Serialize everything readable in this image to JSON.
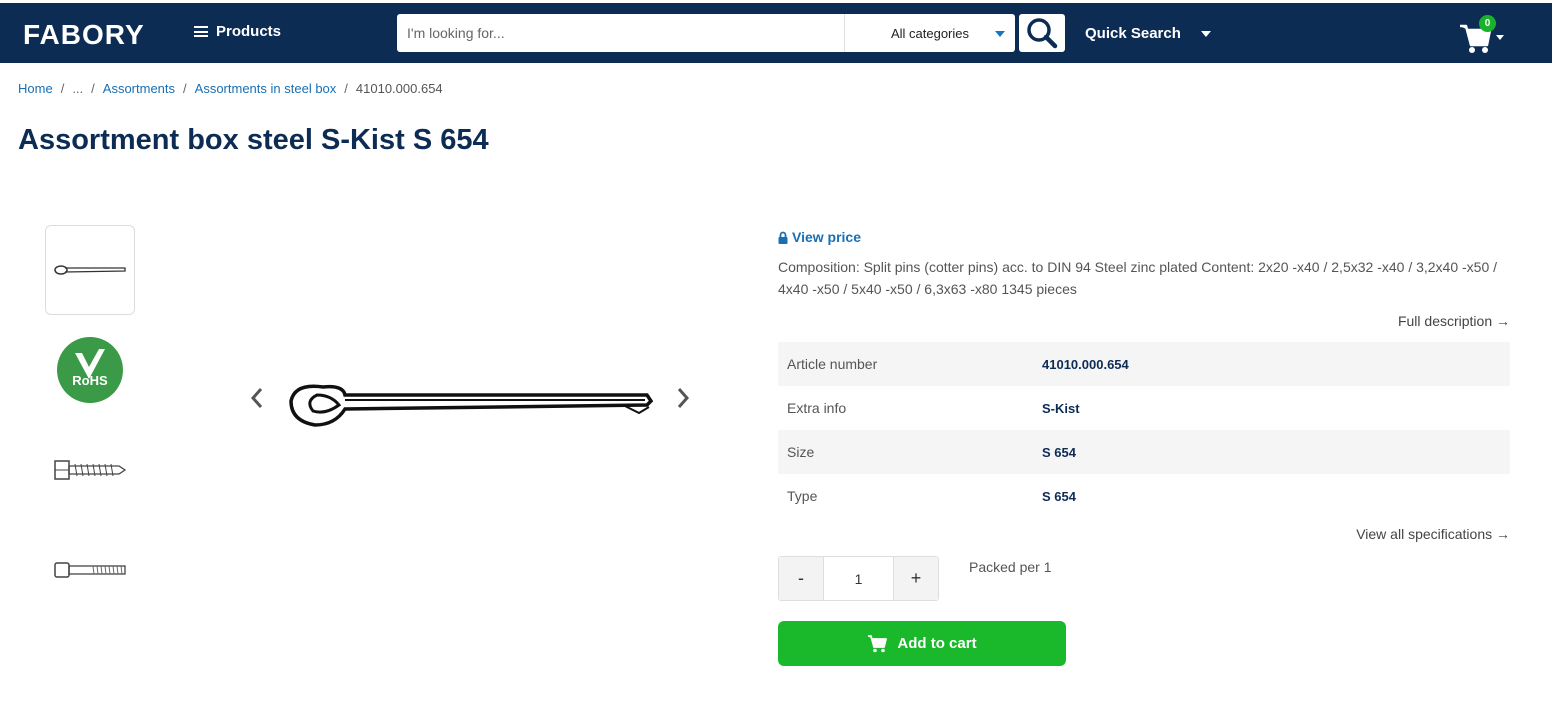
{
  "header": {
    "logo": "FABORY",
    "products_label": "Products",
    "search_placeholder": "I'm looking for...",
    "category_selected": "All categories",
    "quick_search_label": "Quick Search",
    "cart_count": "0"
  },
  "breadcrumb": {
    "items": [
      "Home",
      "...",
      "Assortments",
      "Assortments in steel box",
      "41010.000.654"
    ],
    "separator": "/"
  },
  "page_title": "Assortment box steel S-Kist S 654",
  "gallery": {
    "thumbnails": [
      "split-pin",
      "rohs-logo",
      "hex-lag-screw",
      "socket-cap-screw"
    ],
    "rohs_text": "RoHS"
  },
  "product": {
    "view_price_label": "View price",
    "composition": "Composition: Split pins (cotter pins) acc. to DIN 94 Steel zinc plated Content: 2x20 -x40 / 2,5x32 -x40 / 3,2x40 -x50 / 4x40 -x50 / 5x40 -x50 / 6,3x63 -x80 1345 pieces",
    "full_description_label": "Full description →",
    "specs": [
      {
        "label": "Article number",
        "value": "41010.000.654"
      },
      {
        "label": "Extra info",
        "value": "S-Kist"
      },
      {
        "label": "Size",
        "value": "S 654"
      },
      {
        "label": "Type",
        "value": "S 654"
      }
    ],
    "all_specs_label": "View all specifications →",
    "qty_minus": "-",
    "qty_value": "1",
    "qty_plus": "+",
    "packed_label": "Packed per 1",
    "add_to_cart_label": "Add to cart"
  },
  "colors": {
    "header_bg": "#0d2c54",
    "link": "#1a6fb3",
    "cart_button": "#19b92b",
    "badge": "#18b32a"
  }
}
